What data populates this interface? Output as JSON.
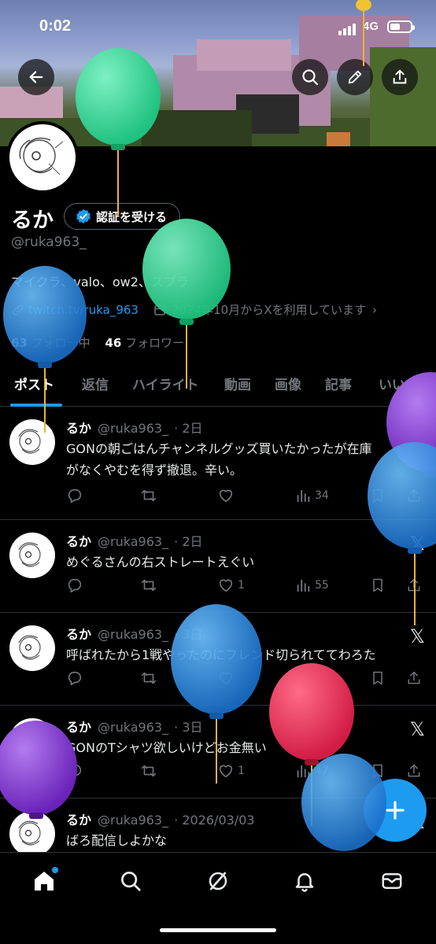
{
  "status_bar": {
    "time": "0:02",
    "network": "4G"
  },
  "header": {
    "back_icon": "arrow-left-icon",
    "search_icon": "search-icon",
    "edit_icon": "pencil-icon",
    "share_icon": "share-icon"
  },
  "profile": {
    "name": "るか",
    "verify_label": "認証を受ける",
    "handle": "@ruka963_",
    "bio": "マイクラ、valo、ow2、スプラ",
    "link": "twitch.tv/ruka_963",
    "joined": "2024年10月からXを利用しています",
    "following_count": "63",
    "following_label": "フォロー中",
    "followers_count": "46",
    "followers_label": "フォロワー"
  },
  "tabs": [
    "ポスト",
    "返信",
    "ハイライト",
    "動画",
    "画像",
    "記事",
    "いいね"
  ],
  "tweets": [
    {
      "name": "るか",
      "handle": "@ruka963_",
      "time": "· 2日",
      "line1": "GONの朝ごはんチャンネルグッズ買いたかったが在庫",
      "line2": "がなくやむを得ず撤退。辛い。",
      "likes": "",
      "views": "34"
    },
    {
      "name": "るか",
      "handle": "@ruka963_",
      "time": "· 2日",
      "line1": "めぐるさんの右ストレートえぐい",
      "line2": "",
      "likes": "1",
      "views": "55"
    },
    {
      "name": "るか",
      "handle": "@ruka963_",
      "time": "· 3日",
      "line1": "呼ばれたから1戦やったのにフレンド切られててわろた",
      "line2": "",
      "likes": "",
      "views": "75"
    },
    {
      "name": "るか",
      "handle": "@ruka963_",
      "time": "· 3日",
      "line1": "GONのTシャツ欲しいけどお金無い",
      "line2": "",
      "likes": "1",
      "views": "47"
    },
    {
      "name": "るか",
      "handle": "@ruka963_",
      "time": "· 2026/03/03",
      "line1": "ばろ配信しよかな",
      "line2": "",
      "likes": "",
      "views": ""
    }
  ],
  "bottom_nav": [
    "home-icon",
    "search-icon",
    "grok-icon",
    "bell-icon",
    "mail-icon"
  ],
  "colors": {
    "accent": "#1d9bf0",
    "background": "#000000",
    "muted": "#71767b",
    "border": "#2f3336"
  }
}
